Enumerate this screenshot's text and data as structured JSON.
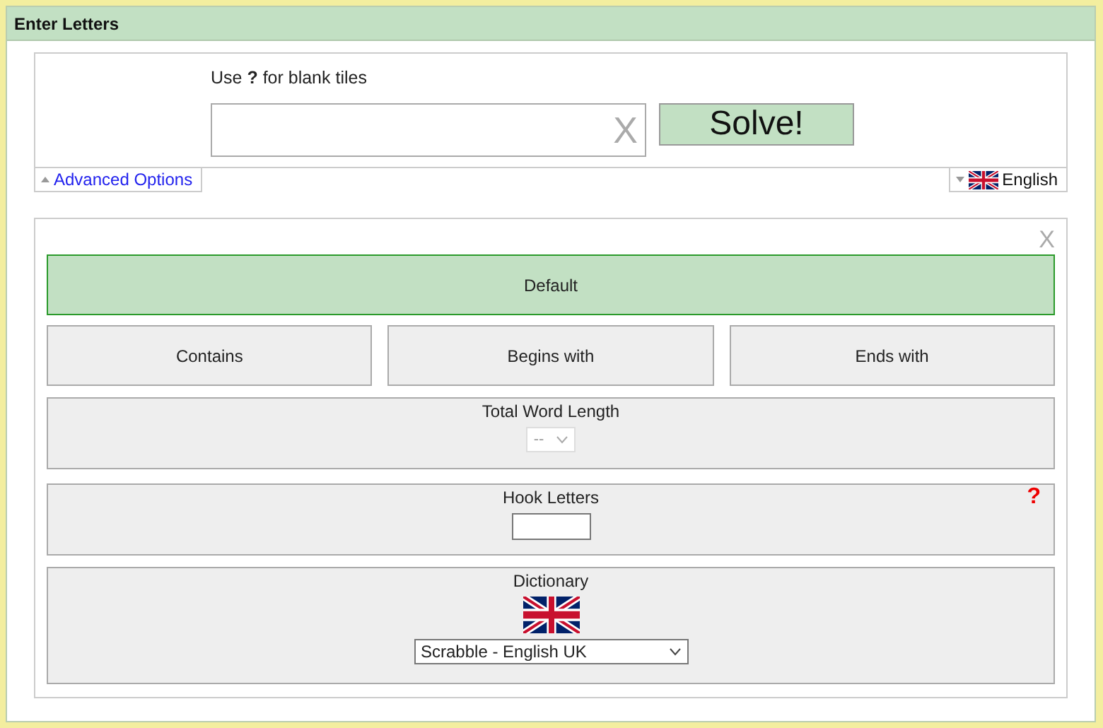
{
  "header": {
    "title": "Enter Letters"
  },
  "search": {
    "hint": "Use **?** for blank tiles",
    "clear_label": "X",
    "solve_label": "Solve!"
  },
  "advanced_toggle": {
    "label": "Advanced Options",
    "expanded": true
  },
  "language": {
    "label": "English"
  },
  "panel": {
    "close_label": "X",
    "modes": [
      {
        "label": "Default",
        "selected": true
      },
      {
        "label": "Contains",
        "selected": false
      },
      {
        "label": "Begins with",
        "selected": false
      },
      {
        "label": "Ends with",
        "selected": false
      }
    ],
    "word_length": {
      "label": "Total Word Length",
      "value": "--",
      "disabled": true
    },
    "hook_letters": {
      "label": "Hook Letters",
      "help": "?"
    },
    "dictionary": {
      "label": "Dictionary",
      "value": "Scrabble - English UK"
    }
  }
}
